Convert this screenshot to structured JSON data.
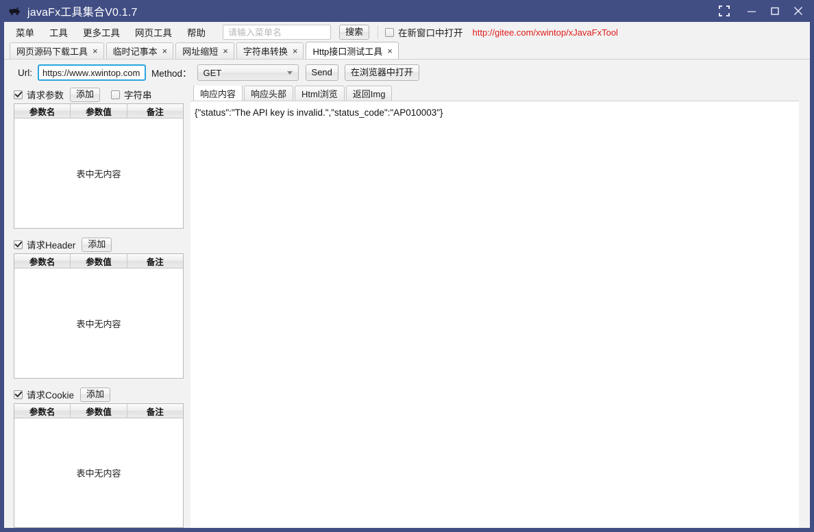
{
  "window": {
    "title": "javaFx工具集合V0.1.7",
    "icon": "app-logo-icon",
    "controls": {
      "fullscreen": "fullscreen-icon",
      "minimize": "minimize-icon",
      "maximize": "maximize-icon",
      "close": "close-icon"
    },
    "titlebar_color": "#414e84"
  },
  "menubar": {
    "items": [
      {
        "label": "菜单"
      },
      {
        "label": "工具"
      },
      {
        "label": "更多工具"
      },
      {
        "label": "网页工具"
      },
      {
        "label": "帮助"
      }
    ],
    "search": {
      "placeholder": "请输入菜单名",
      "value": ""
    },
    "search_button": "搜索",
    "new_window_checkbox": {
      "label": "在新窗口中打开",
      "checked": false
    },
    "link": {
      "text": "http://gitee.com/xwintop/xJavaFxTool",
      "color": "#e01b1b"
    }
  },
  "tabs": [
    {
      "label": "网页源码下载工具",
      "close": "×",
      "active": false
    },
    {
      "label": "临时记事本",
      "close": "×",
      "active": false
    },
    {
      "label": "网址缩短",
      "close": "×",
      "active": false
    },
    {
      "label": "字符串转换",
      "close": "×",
      "active": false
    },
    {
      "label": "Http接口测试工具",
      "close": "×",
      "active": true
    }
  ],
  "request": {
    "url_label": "Url:",
    "url_value": "https://www.xwintop.com",
    "method_label": "Method：",
    "method_value": "GET",
    "send_button": "Send",
    "open_browser_button": "在浏览器中打开",
    "sections": [
      {
        "title": "请求参数",
        "checked": true,
        "add_button": "添加",
        "extra_checkbox": {
          "label": "字符串",
          "checked": false
        },
        "columns": [
          "参数名",
          "参数值",
          "备注"
        ],
        "rows": [],
        "empty_text": "表中无内容"
      },
      {
        "title": "请求Header",
        "checked": true,
        "add_button": "添加",
        "extra_checkbox": null,
        "columns": [
          "参数名",
          "参数值",
          "备注"
        ],
        "rows": [],
        "empty_text": "表中无内容"
      },
      {
        "title": "请求Cookie",
        "checked": true,
        "add_button": "添加",
        "extra_checkbox": null,
        "columns": [
          "参数名",
          "参数值",
          "备注"
        ],
        "rows": [],
        "empty_text": "表中无内容"
      }
    ]
  },
  "response": {
    "tabs": [
      {
        "label": "响应内容",
        "active": true
      },
      {
        "label": "响应头部",
        "active": false
      },
      {
        "label": "Html浏览",
        "active": false
      },
      {
        "label": "返回Img",
        "active": false
      }
    ],
    "content": "{\"status\":\"The API key is invalid.\",\"status_code\":\"AP010003\"}"
  }
}
